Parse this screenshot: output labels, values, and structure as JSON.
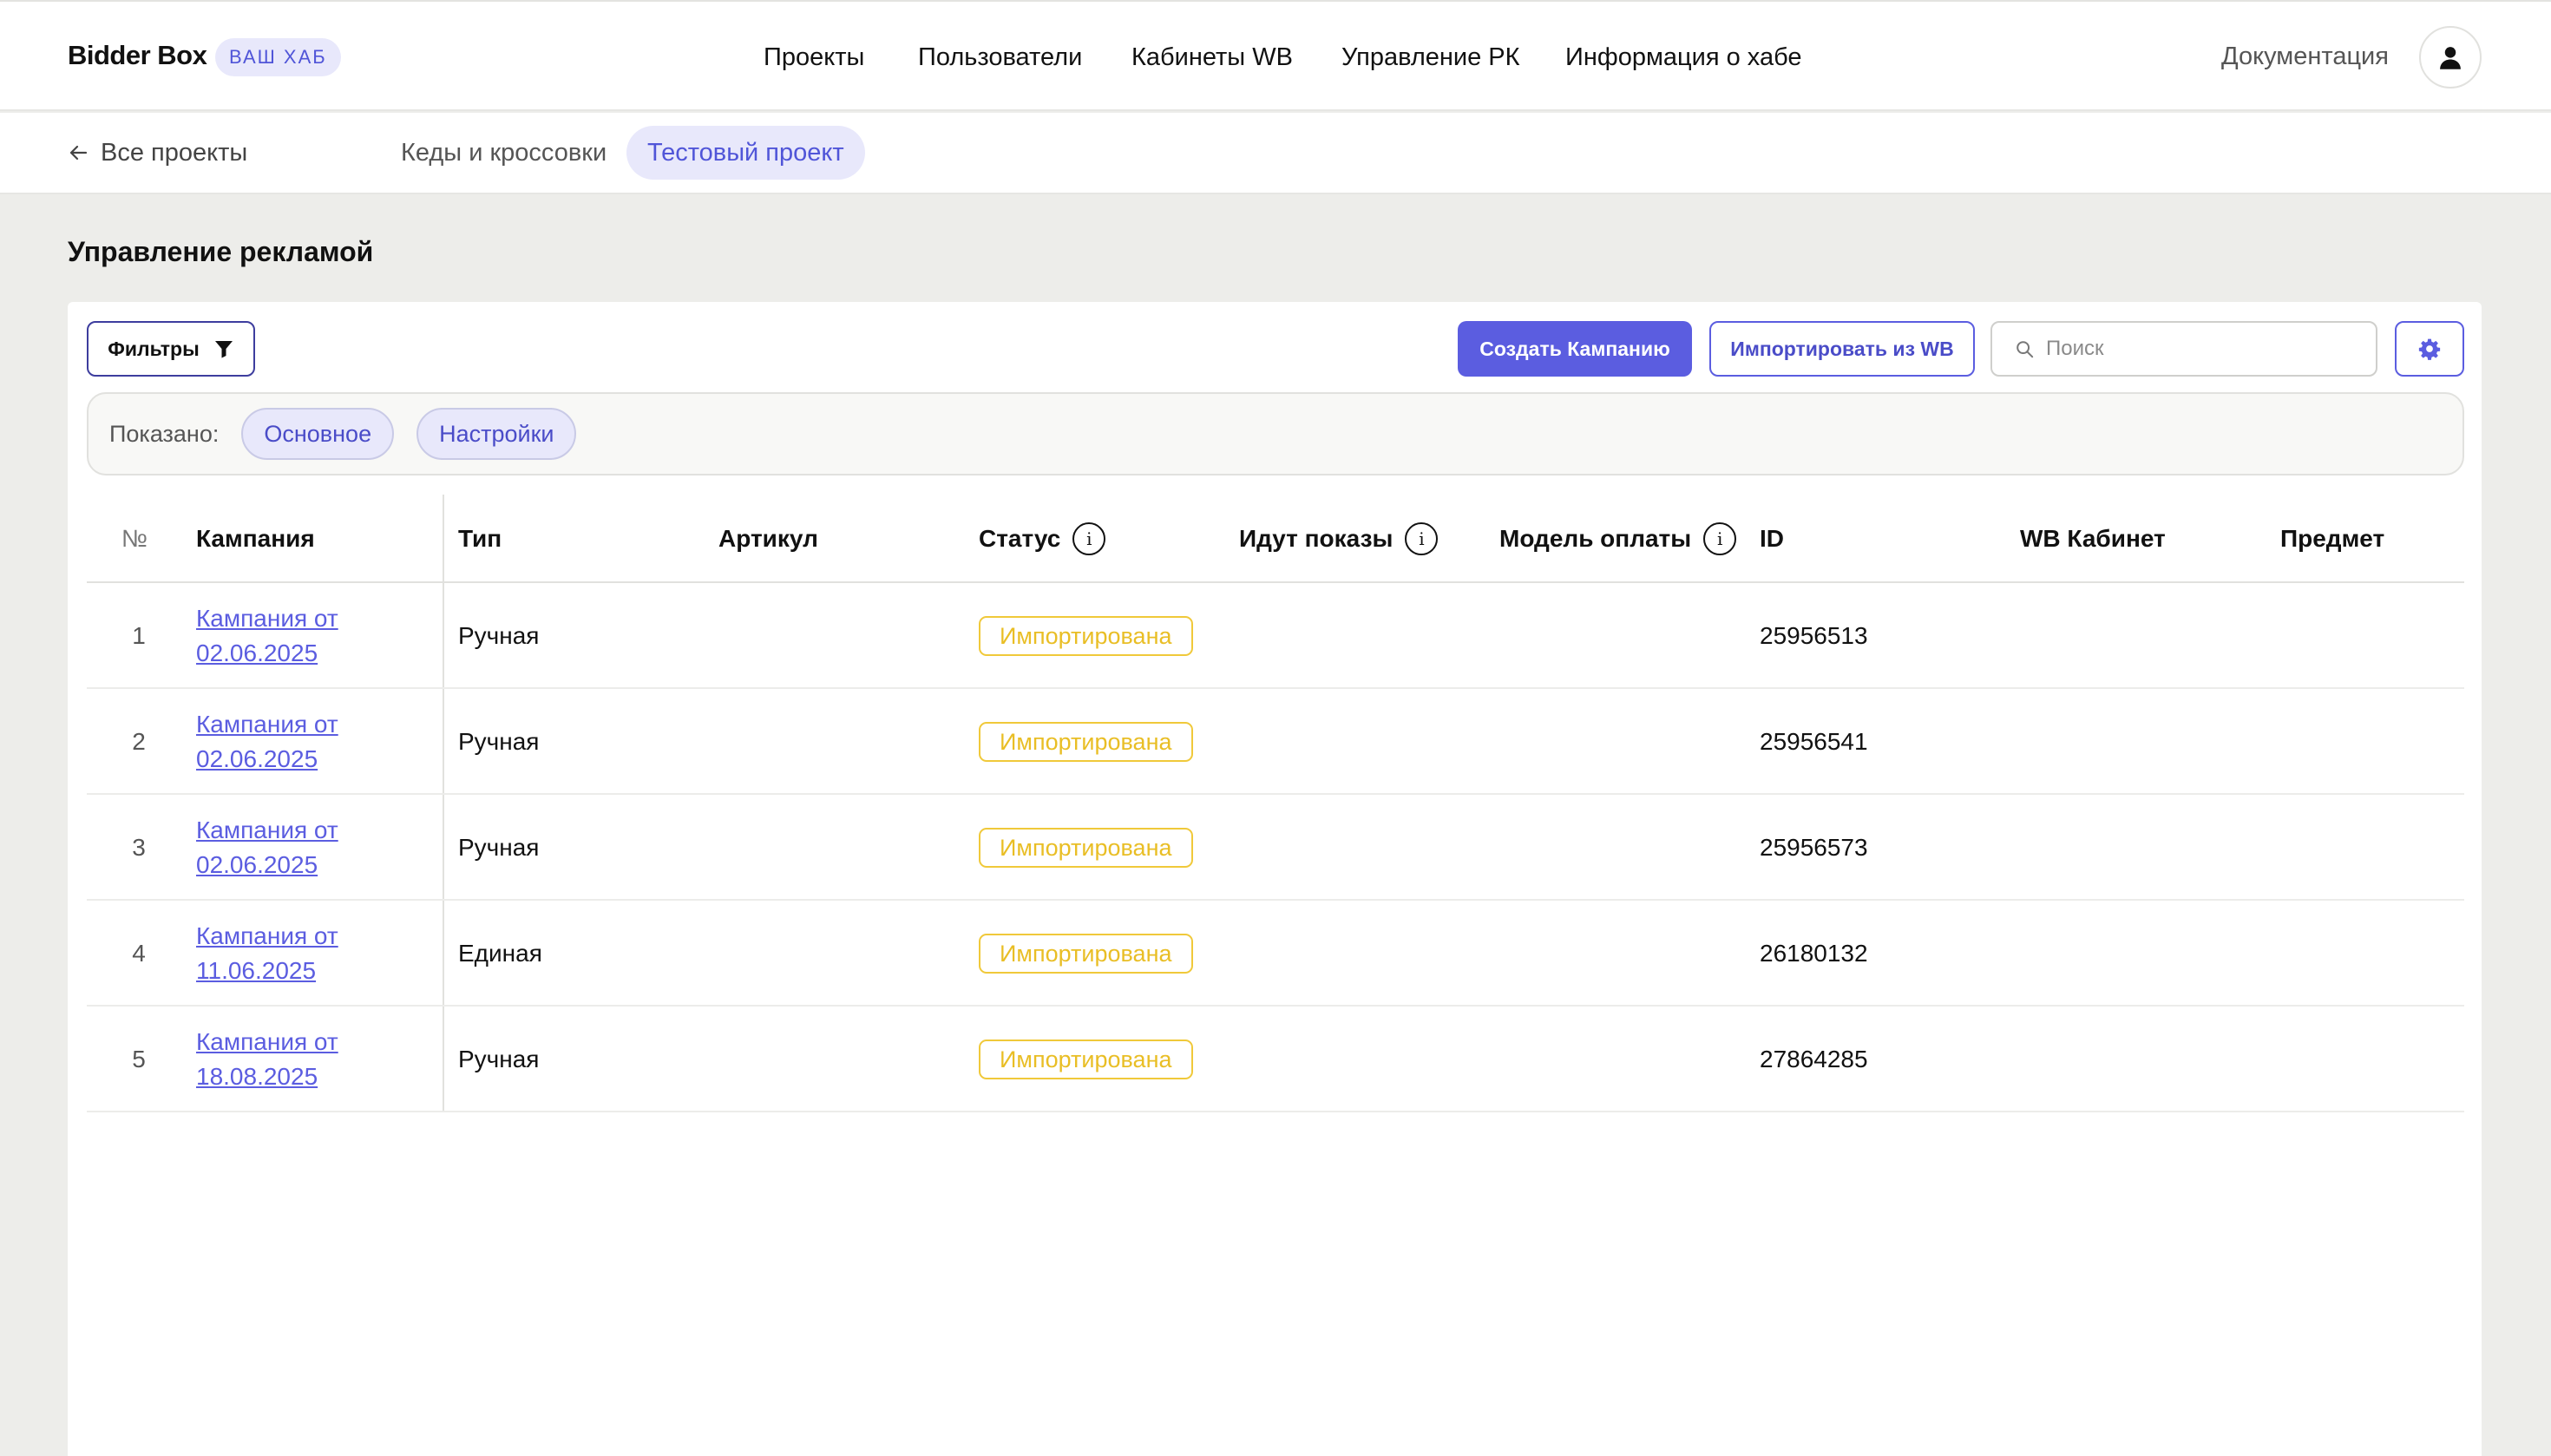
{
  "header": {
    "logo": "Bidder Box",
    "hub_badge": "ВАШ ХАБ",
    "nav": [
      "Проекты",
      "Пользователи",
      "Кабинеты WB",
      "Управление РК",
      "Информация о хабе"
    ],
    "docs": "Документация",
    "avatar_icon": "user-icon"
  },
  "subbar": {
    "back": "Все проекты",
    "back_icon": "arrow-left-icon",
    "projects": [
      "Кеды и кроссовки",
      "Тестовый проект"
    ],
    "active_project": "Тестовый проект"
  },
  "page": {
    "title": "Управление рекламой"
  },
  "toolbar": {
    "filters": "Фильтры",
    "filter_icon": "funnel-icon",
    "create": "Создать Кампанию",
    "import": "Импортировать из WB",
    "search_placeholder": "Поиск",
    "search_icon": "search-icon",
    "settings_icon": "gear-icon"
  },
  "shown": {
    "label": "Показано:",
    "chips": [
      "Основное",
      "Настройки"
    ]
  },
  "table": {
    "columns": [
      "№",
      "Кампания",
      "Тип",
      "Артикул",
      "Статус",
      "Идут показы",
      "Модель оплаты",
      "ID",
      "WB Кабинет",
      "Предмет"
    ],
    "rows": [
      {
        "num": "1",
        "campaign": "Кампания от 02.06.2025",
        "type": "Ручная",
        "status": "Импортирована",
        "id": "25956513"
      },
      {
        "num": "2",
        "campaign": "Кампания от 02.06.2025",
        "type": "Ручная",
        "status": "Импортирована",
        "id": "25956541"
      },
      {
        "num": "3",
        "campaign": "Кампания от 02.06.2025",
        "type": "Ручная",
        "status": "Импортирована",
        "id": "25956573"
      },
      {
        "num": "4",
        "campaign": "Кампания от 11.06.2025",
        "type": "Единая",
        "status": "Импортирована",
        "id": "26180132"
      },
      {
        "num": "5",
        "campaign": "Кампания от 18.08.2025",
        "type": "Ручная",
        "status": "Импортирована",
        "id": "27864285"
      }
    ]
  },
  "colors": {
    "accent": "#5b5de0",
    "accent_soft": "#e8e8fb",
    "status_imported": "#e9be25",
    "page_bg": "#ededea"
  }
}
